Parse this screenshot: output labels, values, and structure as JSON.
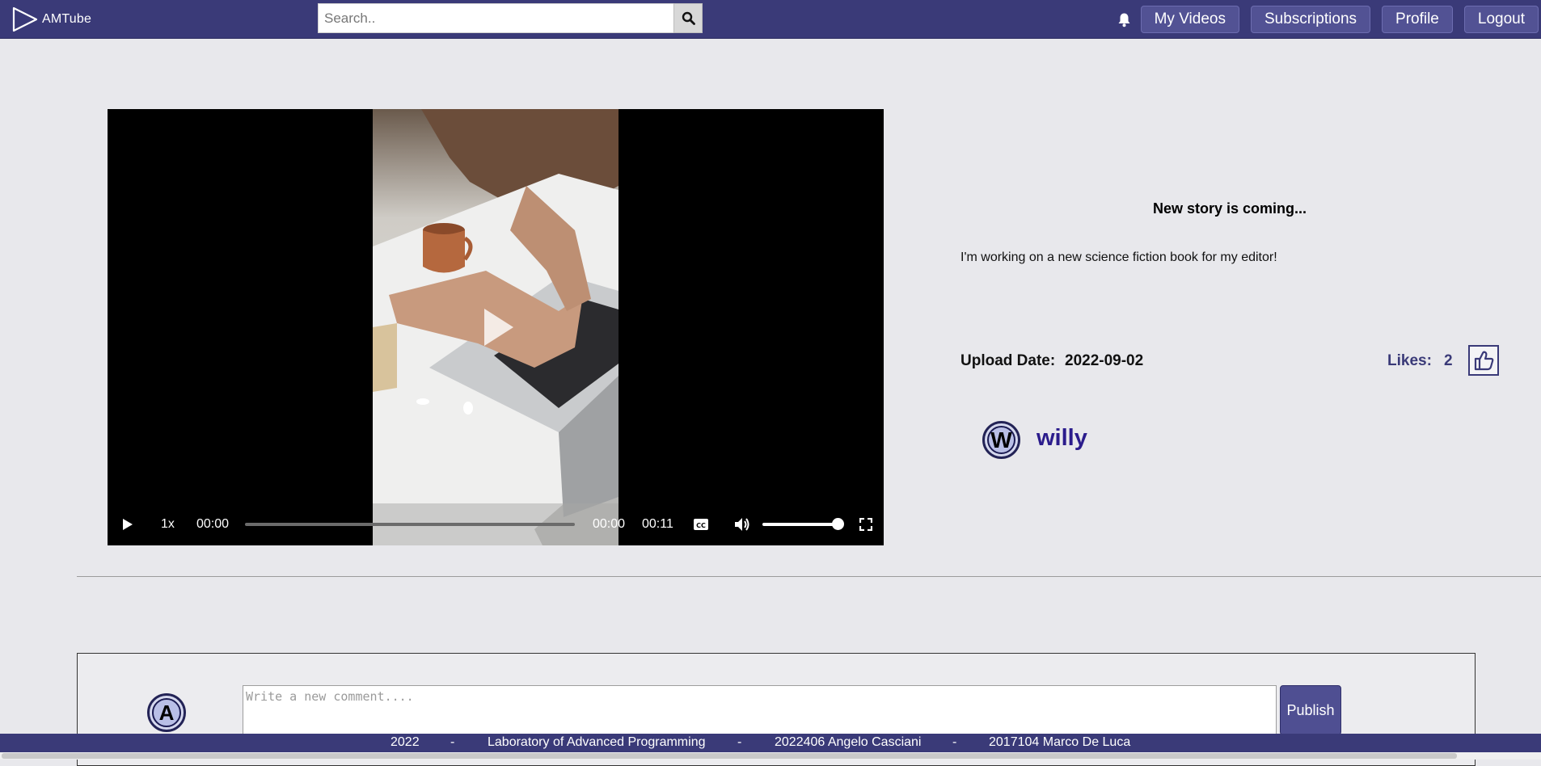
{
  "app": {
    "name": "AMTube"
  },
  "header": {
    "search": {
      "placeholder": "Search..",
      "value": ""
    },
    "nav": {
      "my_videos": "My Videos",
      "subscriptions": "Subscriptions",
      "profile": "Profile",
      "logout": "Logout"
    }
  },
  "video": {
    "title": "New story is coming...",
    "description": "I'm working on a new science fiction book for my editor!",
    "upload_date_label": "Upload Date:",
    "upload_date": "2022-09-02",
    "likes_label": "Likes:",
    "likes": "2",
    "author": {
      "initial": "W",
      "name": "willy"
    },
    "player": {
      "speed": "1x",
      "elapsed": "00:00",
      "current": "00:00",
      "duration": "00:11",
      "progress": 0,
      "volume": 1
    }
  },
  "comment": {
    "user_initial": "A",
    "placeholder": "Write a new comment....",
    "publish_label": "Publish"
  },
  "footer": {
    "year": "2022",
    "course": "Laboratory of Advanced Programming",
    "author1": "2022406 Angelo Casciani",
    "author2": "2017104 Marco De Luca",
    "separator": "-"
  },
  "colors": {
    "primary": "#3a3a78",
    "button": "#525294",
    "author_name": "#2b1c8c"
  }
}
